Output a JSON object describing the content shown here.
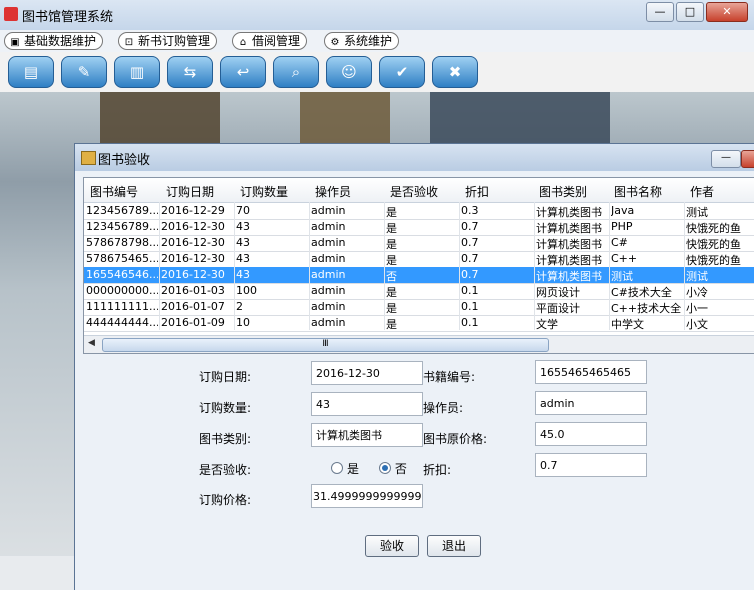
{
  "app": {
    "title": "图书馆管理系统",
    "window_controls": {
      "minimize": "—",
      "maximize": "□",
      "close": "✕"
    }
  },
  "menu": [
    {
      "label": "基础数据维护",
      "icon": "cube-icon",
      "glyph": "▣"
    },
    {
      "label": "新书订购管理",
      "icon": "cart-icon",
      "glyph": "⊡"
    },
    {
      "label": "借阅管理",
      "icon": "lock-icon",
      "glyph": "⌂"
    },
    {
      "label": "系统维护",
      "icon": "settings-icon",
      "glyph": "⚙"
    }
  ],
  "toolbar": [
    {
      "icon": "book-icon",
      "glyph": "▤"
    },
    {
      "icon": "edit-book-icon",
      "glyph": "✎"
    },
    {
      "icon": "books-icon",
      "glyph": "▥"
    },
    {
      "icon": "borrow-icon",
      "glyph": "⇆"
    },
    {
      "icon": "return-icon",
      "glyph": "↩"
    },
    {
      "icon": "search-icon",
      "glyph": "⌕"
    },
    {
      "icon": "reader-icon",
      "glyph": "☺"
    },
    {
      "icon": "check-icon",
      "glyph": "✔"
    },
    {
      "icon": "exit-icon",
      "glyph": "✖"
    }
  ],
  "dialog": {
    "title": "图书验收",
    "table": {
      "columns": [
        "图书编号",
        "订购日期",
        "订购数量",
        "操作员",
        "是否验收",
        "折扣",
        "图书类别",
        "图书名称",
        "作者"
      ],
      "rows": [
        [
          "123456789...",
          "2016-12-29",
          "70",
          "admin",
          "是",
          "0.3",
          "计算机类图书",
          "Java",
          "测试"
        ],
        [
          "123456789...",
          "2016-12-30",
          "43",
          "admin",
          "是",
          "0.7",
          "计算机类图书",
          "PHP",
          "快饿死的鱼"
        ],
        [
          "578678798...",
          "2016-12-30",
          "43",
          "admin",
          "是",
          "0.7",
          "计算机类图书",
          "C#",
          "快饿死的鱼"
        ],
        [
          "578675465...",
          "2016-12-30",
          "43",
          "admin",
          "是",
          "0.7",
          "计算机类图书",
          "C++",
          "快饿死的鱼"
        ],
        [
          "165546546...",
          "2016-12-30",
          "43",
          "admin",
          "否",
          "0.7",
          "计算机类图书",
          "测试",
          "测试"
        ],
        [
          "000000000...",
          "2016-01-03",
          "100",
          "admin",
          "是",
          "0.1",
          "网页设计",
          "C#技术大全",
          "小冷"
        ],
        [
          "111111111...",
          "2016-01-07",
          "2",
          "admin",
          "是",
          "0.1",
          "平面设计",
          "C++技术大全",
          "小一"
        ],
        [
          "444444444...",
          "2016-01-09",
          "10",
          "admin",
          "是",
          "0.1",
          "文学",
          "中学文",
          "小文"
        ]
      ],
      "selected_row": 4,
      "scroll_thumb": "Ⅲ"
    },
    "form": {
      "order_date_label": "订购日期:",
      "order_date": "2016-12-30",
      "book_id_label": "书籍编号:",
      "book_id": "1655465465465",
      "quantity_label": "订购数量:",
      "quantity": "43",
      "operator_label": "操作员:",
      "operator": "admin",
      "category_label": "图书类别:",
      "category": "计算机类图书",
      "original_price_label": "图书原价格:",
      "original_price": "45.0",
      "accepted_label": "是否验收:",
      "yes_label": "是",
      "no_label": "否",
      "accepted": "否",
      "discount_label": "折扣:",
      "discount": "0.7",
      "order_price_label": "订购价格:",
      "order_price": "31.4999999999999996"
    },
    "buttons": {
      "accept": "验收",
      "exit": "退出"
    }
  }
}
